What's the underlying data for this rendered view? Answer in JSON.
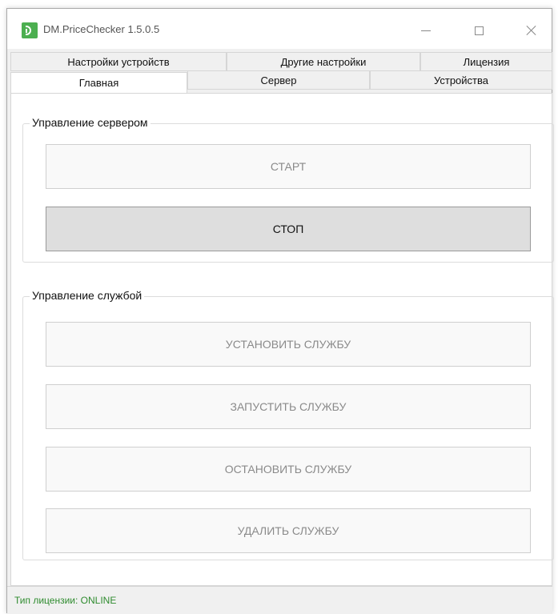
{
  "window": {
    "title": "DM.PriceChecker 1.5.0.5",
    "icon": "app-icon",
    "controls": {
      "minimize_icon": "minimize-icon",
      "maximize_icon": "maximize-icon",
      "close_icon": "close-icon"
    }
  },
  "tabs": {
    "row1": [
      {
        "label": "Настройки устройств"
      },
      {
        "label": "Другие настройки"
      },
      {
        "label": "Лицензия"
      }
    ],
    "row2": [
      {
        "label": "Главная",
        "selected": true
      },
      {
        "label": "Сервер"
      },
      {
        "label": "Устройства"
      }
    ]
  },
  "server_group": {
    "title": "Управление сервером",
    "start_label": "СТАРТ",
    "stop_label": "СТОП",
    "start_enabled": false,
    "stop_enabled": true
  },
  "service_group": {
    "title": "Управление службой",
    "install_label": "УСТАНОВИТЬ СЛУЖБУ",
    "run_label": "ЗАПУСТИТЬ СЛУЖБУ",
    "stop_label": "ОСТАНОВИТЬ СЛУЖБУ",
    "delete_label": "УДАЛИТЬ СЛУЖБУ",
    "enabled": false
  },
  "status": {
    "license_text": "Тип лицензии: ONLINE",
    "color": "#2e8b2e"
  },
  "colors": {
    "accent": "#4caf50",
    "window_bg": "#f0f0f0",
    "content_bg": "#ffffff",
    "active_button_bg": "#dedede"
  }
}
